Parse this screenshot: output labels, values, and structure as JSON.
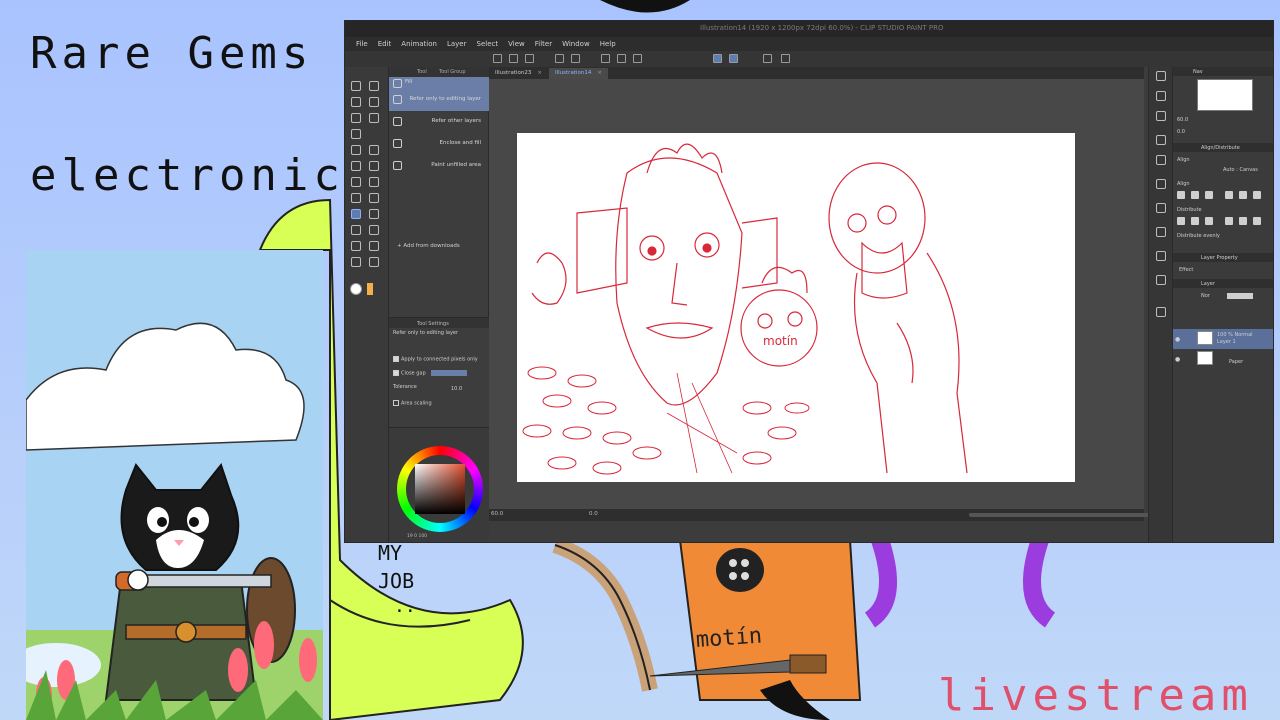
{
  "overlay": {
    "title_line1": "Rare Gems",
    "title_line2": "electronic",
    "footer": "livestream"
  },
  "background_art": {
    "creature_text_top": "MY",
    "creature_text_bottom": "JOB",
    "shirt_text": "motín"
  },
  "app": {
    "window_title": "Illustration14 (1920 x 1200px 72dpi 60.0%) - CLIP STUDIO PAINT PRO",
    "menu": [
      "File",
      "Edit",
      "Animation",
      "Layer",
      "Select",
      "View",
      "Filter",
      "Window",
      "Help"
    ],
    "tabs": [
      {
        "label": "Illustration23",
        "active": false
      },
      {
        "label": "Illustration14",
        "active": true
      }
    ],
    "subtool": {
      "tab_tool": "Tool",
      "tab_group": "Tool Group",
      "items": [
        {
          "label": "Fill",
          "selected": true
        },
        {
          "label": "Refer only to editing layer",
          "selected": true
        },
        {
          "label": "Refer other layers",
          "selected": false
        },
        {
          "label": "Enclose and fill",
          "selected": false
        },
        {
          "label": "Paint unfilled area",
          "selected": false
        }
      ],
      "add_downloads": "Add from downloads"
    },
    "tool_settings": {
      "header": "Tool Settings",
      "current": "Refer only to editing layer",
      "apply_connected": "Apply to connected pixels only",
      "close_gap": "Close gap",
      "tolerance_label": "Tolerance",
      "tolerance_value": "10.0",
      "area_scaling": "Area scaling"
    },
    "color": {
      "values_text": "19  0  100"
    },
    "navigator": {
      "zoom": "60.0",
      "rotation": "0.0"
    },
    "statusbar": {
      "zoom": "60.0",
      "rotation": "0.0"
    },
    "right_panel": {
      "navigator_tab": "Nav",
      "align_header": "Align/Distribute",
      "align_label": "Align",
      "align_target": "Auto : Canvas",
      "align_section": "Align",
      "distribute_section": "Distribute",
      "distribute_evenly": "Distribute evenly",
      "layer_property": "Layer Property",
      "effect": "Effect",
      "layer_tab": "Layer",
      "blend_mode": "Nor",
      "layers": [
        {
          "name": "100 % Normal",
          "sub": "Layer 1",
          "selected": true
        },
        {
          "name": "Paper",
          "sub": "",
          "selected": false
        }
      ]
    },
    "accent_color": "#6a7ea8",
    "sketch_color": "#d8283a",
    "sketch_text": "motín"
  }
}
